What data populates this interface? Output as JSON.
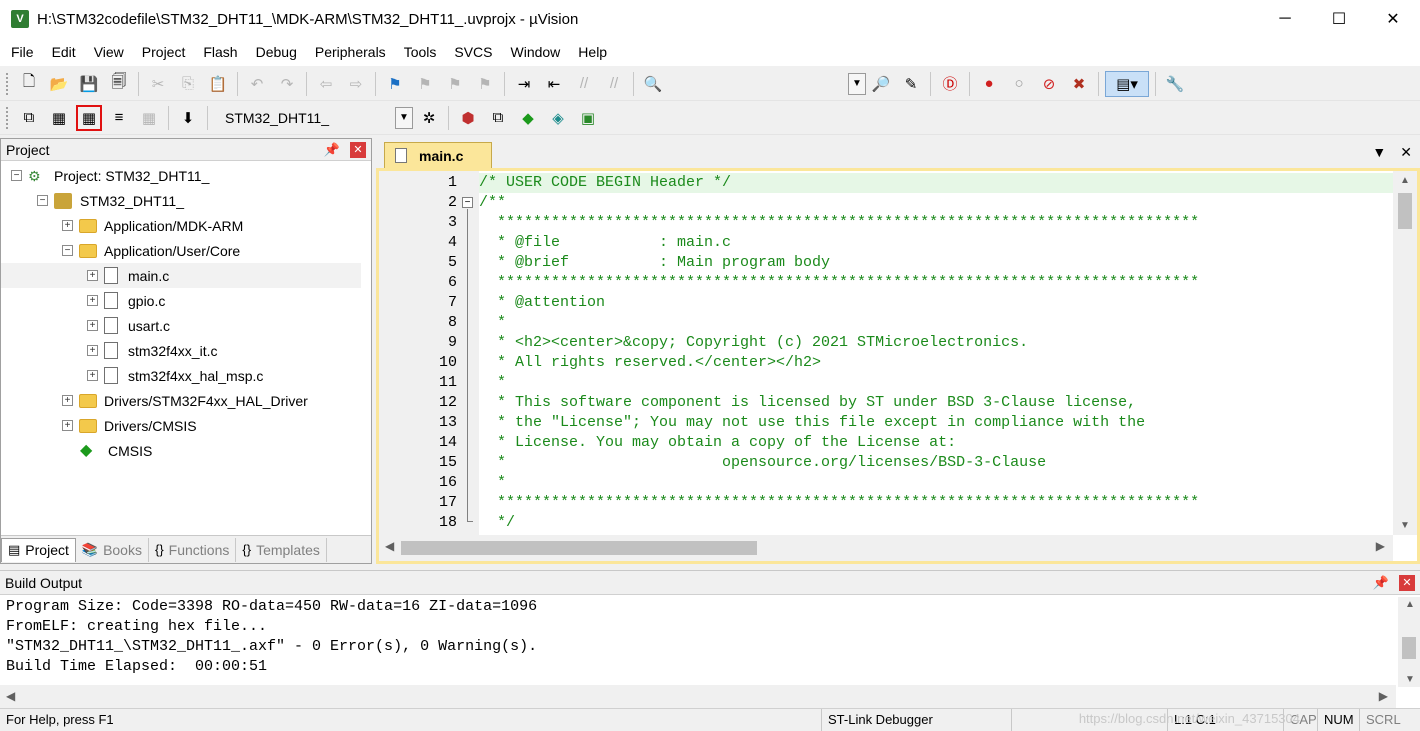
{
  "window": {
    "title": "H:\\STM32codefile\\STM32_DHT11_\\MDK-ARM\\STM32_DHT11_.uvprojx - µVision",
    "minimize": "─",
    "maximize": "☐",
    "close": "✕"
  },
  "menu": [
    "File",
    "Edit",
    "View",
    "Project",
    "Flash",
    "Debug",
    "Peripherals",
    "Tools",
    "SVCS",
    "Window",
    "Help"
  ],
  "toolbar": {
    "target_select": "STM32_DHT11_"
  },
  "project_panel": {
    "title": "Project",
    "tree": [
      {
        "label": "Project: STM32_DHT11_",
        "icon": "project-icon",
        "level": 0,
        "expander": "−"
      },
      {
        "label": "STM32_DHT11_",
        "icon": "target-icon",
        "level": 1,
        "expander": "−"
      },
      {
        "label": "Application/MDK-ARM",
        "icon": "folder-icon",
        "level": 2,
        "expander": "+"
      },
      {
        "label": "Application/User/Core",
        "icon": "folder-icon",
        "level": 2,
        "expander": "−"
      },
      {
        "label": "main.c",
        "icon": "file-icon",
        "level": 3,
        "expander": "+",
        "selected": true
      },
      {
        "label": "gpio.c",
        "icon": "file-icon",
        "level": 3,
        "expander": "+"
      },
      {
        "label": "usart.c",
        "icon": "file-icon",
        "level": 3,
        "expander": "+"
      },
      {
        "label": "stm32f4xx_it.c",
        "icon": "file-icon",
        "level": 3,
        "expander": "+"
      },
      {
        "label": "stm32f4xx_hal_msp.c",
        "icon": "file-icon",
        "level": 3,
        "expander": "+"
      },
      {
        "label": "Drivers/STM32F4xx_HAL_Driver",
        "icon": "folder-icon",
        "level": 2,
        "expander": "+"
      },
      {
        "label": "Drivers/CMSIS",
        "icon": "folder-icon",
        "level": 2,
        "expander": "+"
      },
      {
        "label": "CMSIS",
        "icon": "cmsis-icon",
        "level": 2,
        "expander": ""
      }
    ],
    "tabs": [
      {
        "label": "Project",
        "icon": "project-tab-icon",
        "active": true
      },
      {
        "label": "Books",
        "icon": "books-icon",
        "active": false
      },
      {
        "label": "Functions",
        "icon": "functions-icon",
        "active": false
      },
      {
        "label": "Templates",
        "icon": "templates-icon",
        "active": false
      }
    ]
  },
  "editor": {
    "tab_label": "main.c",
    "lines": [
      {
        "n": "1",
        "text": "/* USER CODE BEGIN Header */"
      },
      {
        "n": "2",
        "text": "/**"
      },
      {
        "n": "3",
        "text": "  ******************************************************************************"
      },
      {
        "n": "4",
        "text": "  * @file           : main.c"
      },
      {
        "n": "5",
        "text": "  * @brief          : Main program body"
      },
      {
        "n": "6",
        "text": "  ******************************************************************************"
      },
      {
        "n": "7",
        "text": "  * @attention"
      },
      {
        "n": "8",
        "text": "  *"
      },
      {
        "n": "9",
        "text": "  * <h2><center>&copy; Copyright (c) 2021 STMicroelectronics."
      },
      {
        "n": "10",
        "text": "  * All rights reserved.</center></h2>"
      },
      {
        "n": "11",
        "text": "  *"
      },
      {
        "n": "12",
        "text": "  * This software component is licensed by ST under BSD 3-Clause license,"
      },
      {
        "n": "13",
        "text": "  * the \"License\"; You may not use this file except in compliance with the"
      },
      {
        "n": "14",
        "text": "  * License. You may obtain a copy of the License at:"
      },
      {
        "n": "15",
        "text": "  *                        opensource.org/licenses/BSD-3-Clause"
      },
      {
        "n": "16",
        "text": "  *"
      },
      {
        "n": "17",
        "text": "  ******************************************************************************"
      },
      {
        "n": "18",
        "text": "  */"
      }
    ]
  },
  "build_output": {
    "title": "Build Output",
    "lines": [
      "Program Size: Code=3398 RO-data=450 RW-data=16 ZI-data=1096",
      "FromELF: creating hex file...",
      "\"STM32_DHT11_\\STM32_DHT11_.axf\" - 0 Error(s), 0 Warning(s).",
      "Build Time Elapsed:  00:00:51"
    ]
  },
  "status": {
    "help": "For Help, press F1",
    "debugger": "ST-Link Debugger",
    "position": "L:1 C:1",
    "cap": "CAP",
    "num": "NUM",
    "scrl": "SCRL",
    "watermark": "https://blog.csdn.net/weixin_43715304"
  },
  "colors": {
    "comment": "#1b8a1b",
    "tab_active": "#fbe69a",
    "current_line": "#e6f7e6"
  }
}
